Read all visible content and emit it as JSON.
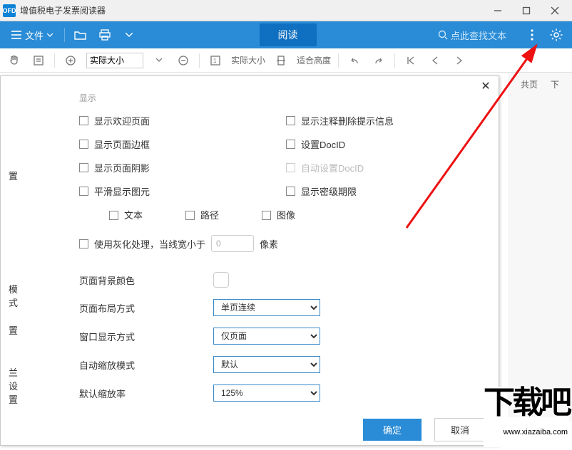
{
  "titlebar": {
    "appicon": "OFD",
    "title": "增值税电子发票阅读器"
  },
  "menubar": {
    "file": "文件",
    "read": "阅读",
    "search_placeholder": "点此查找文本"
  },
  "toolbar": {
    "zoom_value": "实际大小",
    "actual_size": "实际大小",
    "fit_height": "适合高度",
    "page_label": "共页",
    "down_label": "下"
  },
  "rightstrip": {
    "page": "共页",
    "down": "下"
  },
  "dialog": {
    "group": "显示",
    "left_checks": [
      "显示欢迎页面",
      "显示页面边框",
      "显示页面阴影",
      "平滑显示图元"
    ],
    "right_checks": [
      "显示注释删除提示信息",
      "设置DocID",
      "自动设置DocID",
      "显示密级期限"
    ],
    "sub_checks": [
      "文本",
      "路径",
      "图像"
    ],
    "grayline_prefix": "使用灰化处理，当线宽小于",
    "grayline_value": "0",
    "grayline_suffix": "像素",
    "form": {
      "bgcolor": "页面背景颜色",
      "layout": {
        "label": "页面布局方式",
        "value": "单页连续"
      },
      "window": {
        "label": "窗口显示方式",
        "value": "仅页面"
      },
      "autozoom": {
        "label": "自动缩放模式",
        "value": "默认"
      },
      "defaultzoom": {
        "label": "默认缩放率",
        "value": "125%"
      }
    },
    "nav": [
      "置",
      "模式",
      "置",
      "兰设置"
    ],
    "ok": "确定",
    "cancel": "取消"
  },
  "watermark": {
    "text": "下载吧",
    "url": "www.xiazaiba.com"
  }
}
